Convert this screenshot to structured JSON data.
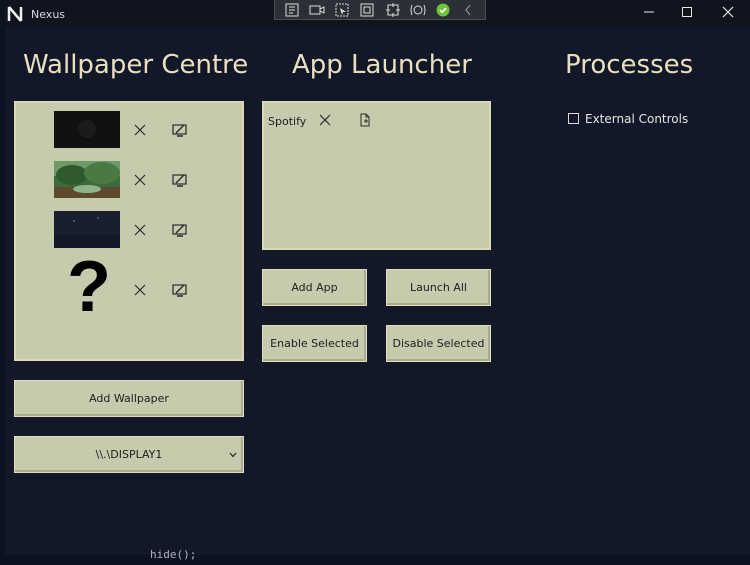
{
  "window": {
    "title": "Nexus"
  },
  "sections": {
    "wallpaper": "Wallpaper Centre",
    "launcher": "App Launcher",
    "processes": "Processes"
  },
  "wallpapers": [
    {
      "thumb": "dark-image"
    },
    {
      "thumb": "forest-image"
    },
    {
      "thumb": "night-image"
    },
    {
      "thumb": "question-mark"
    }
  ],
  "wallpaper_buttons": {
    "add": "Add Wallpaper",
    "display": "\\\\.\\DISPLAY1"
  },
  "apps": [
    {
      "name": "Spotify"
    }
  ],
  "launcher_buttons": {
    "add": "Add App",
    "launch_all": "Launch All",
    "enable": "Enable Selected",
    "disable": "Disable Selected"
  },
  "processes": {
    "external_controls": "External Controls"
  },
  "placeholder_glyph": "?",
  "background_code": "hide();",
  "colors": {
    "panel": "#c5ccae",
    "heading": "#e9dfc0",
    "background": "#121828"
  }
}
